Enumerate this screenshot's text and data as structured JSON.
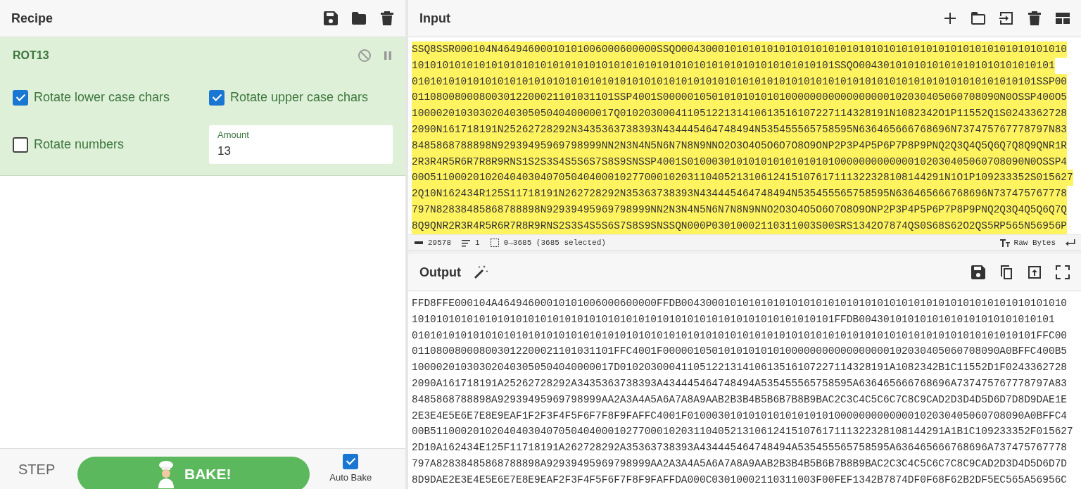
{
  "recipe": {
    "title": "Recipe"
  },
  "operations": [
    {
      "name": "ROT13",
      "options": [
        {
          "kind": "checkbox",
          "label": "Rotate lower case chars",
          "checked": true
        },
        {
          "kind": "checkbox",
          "label": "Rotate upper case chars",
          "checked": true
        },
        {
          "kind": "checkbox",
          "label": "Rotate numbers",
          "checked": false
        },
        {
          "kind": "number",
          "label": "Amount",
          "value": "13"
        }
      ]
    }
  ],
  "controls": {
    "step": "STEP",
    "bake": "BAKE!",
    "auto_bake": {
      "label": "Auto Bake",
      "checked": true
    }
  },
  "input": {
    "title": "Input",
    "selected": true,
    "lines": [
      "SSQ8SSR000104N46494600010101006000600000SSQO004300010101010101010101010101010101010101010101010101010101010",
      "101010101010101010101010101010101010101010101010101010101010101010101SSQO00430101010101010101010101010101",
      "010101010101010101010101010101010101010101010101010101010101010101010101010101010101010101010101010101SSP00",
      "011080080008003012200021101031101SSP4001S0000010501010101010100000000000000000102030405060708090N0OSSP400O5",
      "100002010303020403050504040000017Q01020300041105122131410613516107227114328191N1082342O1P11552Q1S0243362728",
      "2090N161718191N25262728292N3435363738393N434445464748494N535455565758595N636465666768696N737475767778797N83",
      "8485868788898N92939495969798999NN2N3N4N5N6N7N8N9NNO2O3O4O5O6O7O8O9ONP2P3P4P5P6P7P8P9PNQ2Q3Q4Q5Q6Q7Q8Q9QNR1R",
      "2R3R4R5R6R7R8R9RNS1S2S3S4S5S6S7S8S9SNSSP4001S0100030101010101010101010000000000000102030405060708090N0OSSP4",
      "00O511000201020404030407050404000102770001020311040521310612415107617111322328108144291N1O1P109233352S015627",
      "2Q10N162434R125S11718191N262728292N35363738393N434445464748494N535455565758595N636465666768696N737475767778",
      "797N82838485868788898N92939495969798999NN2N3N4N5N6N7N8N9NNO2O3O4O5O6O7O8O9ONP2P3P4P5P6P7P8P9PNQ2Q3Q4Q5Q6Q7Q",
      "8Q9QNR2R3R4R5R6R7R8R9RNS2S3S4S5S6S7S8S9SNSSQN000P03010002110311003S00SRS1342O7874QS0S68S62O2QS5RP565N56956P"
    ],
    "status": {
      "length": "29578",
      "lines": "1",
      "selection": "0→3685 (3685 selected)",
      "encoding": "Raw Bytes"
    }
  },
  "output": {
    "title": "Output",
    "lines": [
      "FFD8FFE000104A46494600010101006000600000FFDB004300010101010101010101010101010101010101010101010101010101010",
      "101010101010101010101010101010101010101010101010101010101010101010101FFDB00430101010101010101010101010101",
      "010101010101010101010101010101010101010101010101010101010101010101010101010101010101010101010101010101FFC00",
      "011080080008003012200021101031101FFC4001F0000010501010101010100000000000000000102030405060708090A0BFFC400B5",
      "100002010303020403050504040000017D01020300041105122131410613516107227114328191A1082342B1C11552D1F0243362728",
      "2090A161718191A25262728292A3435363738393A434445464748494A535455565758595A636465666768696A737475767778797A83",
      "8485868788898A92939495969798999AA2A3A4A5A6A7A8A9AAB2B3B4B5B6B7B8B9BAC2C3C4C5C6C7C8C9CAD2D3D4D5D6D7D8D9DAE1E",
      "2E3E4E5E6E7E8E9EAF1F2F3F4F5F6F7F8F9FAFFC4001F0100030101010101010101010000000000000102030405060708090A0BFFC4",
      "00B511000201020404030407050404000102770001020311040521310612415107617111322328108144291A1B1C109233352F015627",
      "2D10A162434E125F11718191A262728292A35363738393A434445464748494A535455565758595A636465666768696A737475767778",
      "797A82838485868788898A92939495969798999AA2A3A4A5A6A7A8A9AAB2B3B4B5B6B7B8B9BAC2C3C4C5C6C7C8C9CAD2D3D4D5D6D7D",
      "8D9DAE2E3E4E5E6E7E8E9EAF2F3F4F5F6F7F8F9FAFFDA000C03010002110311003F00FEF1342B7874DF0F68F62B2DF5EC565A56956C"
    ]
  }
}
